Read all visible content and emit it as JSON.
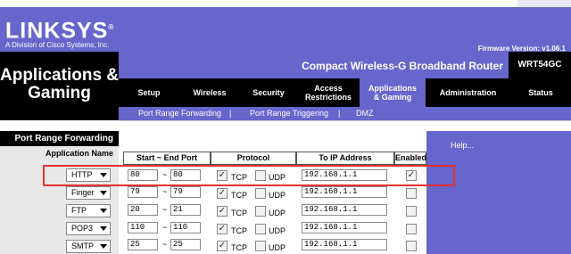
{
  "header": {
    "logo": "LINKSYS",
    "logo_mark": "®",
    "logo_sub": "A Division of Cisco Systems, Inc.",
    "firmware": "Firmware Version: v1.06.1"
  },
  "section_title_line1": "Applications &",
  "section_title_line2": "Gaming",
  "model": {
    "name": "Compact Wireless-G Broadband Router",
    "number": "WRT54GC"
  },
  "tabs": [
    {
      "label": "Setup"
    },
    {
      "label": "Wireless"
    },
    {
      "label": "Security"
    },
    {
      "label": "Access Restrictions"
    },
    {
      "label": "Applications & Gaming"
    },
    {
      "label": "Administration"
    },
    {
      "label": "Status"
    }
  ],
  "subtabs": [
    {
      "label": "Port Range Forwarding"
    },
    {
      "label": "|"
    },
    {
      "label": "Port Range Triggering"
    },
    {
      "label": "|"
    },
    {
      "label": "DMZ"
    }
  ],
  "left": {
    "heading": "Port Range Forwarding",
    "column_label": "Application Name"
  },
  "table": {
    "headers": [
      "Start ~ End Port",
      "Protocol",
      "To IP Address",
      "Enabled"
    ],
    "rows": [
      {
        "app": "HTTP",
        "start": "80",
        "end": "80",
        "tcp": "✓",
        "udp": "",
        "tcp_label": "TCP",
        "udp_label": "UDP",
        "ip": "192.168.1.1",
        "enabled": "✓"
      },
      {
        "app": "Finger",
        "start": "79",
        "end": "79",
        "tcp": "✓",
        "udp": "",
        "tcp_label": "TCP",
        "udp_label": "UDP",
        "ip": "192.168.1.1",
        "enabled": ""
      },
      {
        "app": "FTP",
        "start": "20",
        "end": "21",
        "tcp": "✓",
        "udp": "",
        "tcp_label": "TCP",
        "udp_label": "UDP",
        "ip": "192.168.1.1",
        "enabled": ""
      },
      {
        "app": "POP3",
        "start": "110",
        "end": "110",
        "tcp": "✓",
        "udp": "",
        "tcp_label": "TCP",
        "udp_label": "UDP",
        "ip": "192.168.1.1",
        "enabled": ""
      },
      {
        "app": "SMTP",
        "start": "25",
        "end": "25",
        "tcp": "✓",
        "udp": "",
        "tcp_label": "TCP",
        "udp_label": "UDP",
        "ip": "192.168.1.1",
        "enabled": ""
      }
    ],
    "tilde": "~"
  },
  "help": "Help...",
  "colors": {
    "brand": "#6666cc",
    "highlight": "#e53030"
  }
}
